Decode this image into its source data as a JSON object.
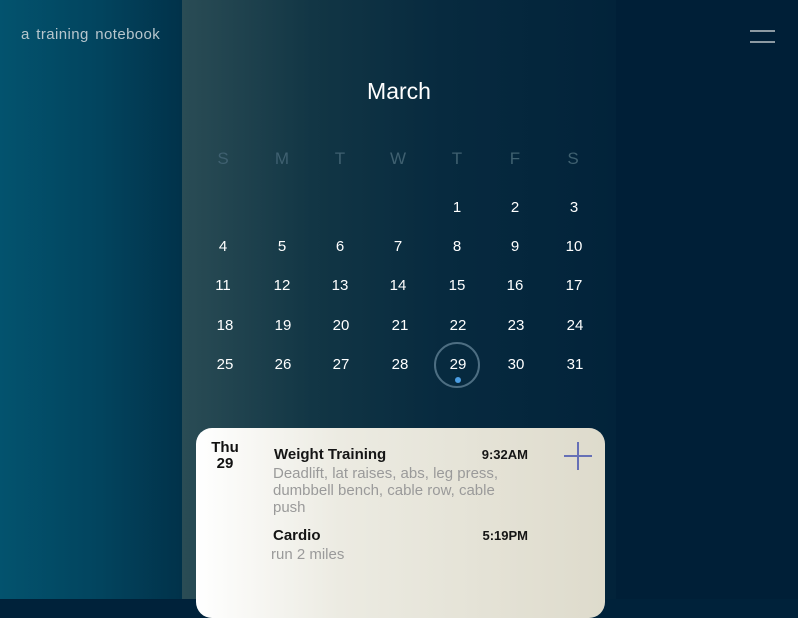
{
  "app": {
    "title": "a training notebook"
  },
  "calendar": {
    "month": "March",
    "weekdays": [
      "S",
      "M",
      "T",
      "W",
      "T",
      "F",
      "S"
    ],
    "days": [
      "1",
      "2",
      "3",
      "4",
      "5",
      "6",
      "7",
      "8",
      "9",
      "10",
      "11",
      "12",
      "13",
      "14",
      "15",
      "16",
      "17",
      "18",
      "19",
      "20",
      "21",
      "22",
      "23",
      "24",
      "25",
      "26",
      "27",
      "28",
      "29",
      "30",
      "31"
    ],
    "selected_day": "29"
  },
  "day_card": {
    "weekday": "Thu",
    "date": "29",
    "events": [
      {
        "title": "Weight Training",
        "time": "9:32AM",
        "detail_line1": "Deadlift, lat raises, abs, leg press,",
        "detail_line2": "dumbbell bench, cable row, cable",
        "detail_line3": "push"
      },
      {
        "title": "Cardio",
        "time": "5:19PM",
        "detail_line1": "run 2 miles"
      }
    ]
  },
  "colors": {
    "accent_dot": "#4b9de2",
    "add_icon": "#6670b6"
  },
  "icons": {
    "menu": "hamburger-menu-icon",
    "add": "plus-icon"
  }
}
